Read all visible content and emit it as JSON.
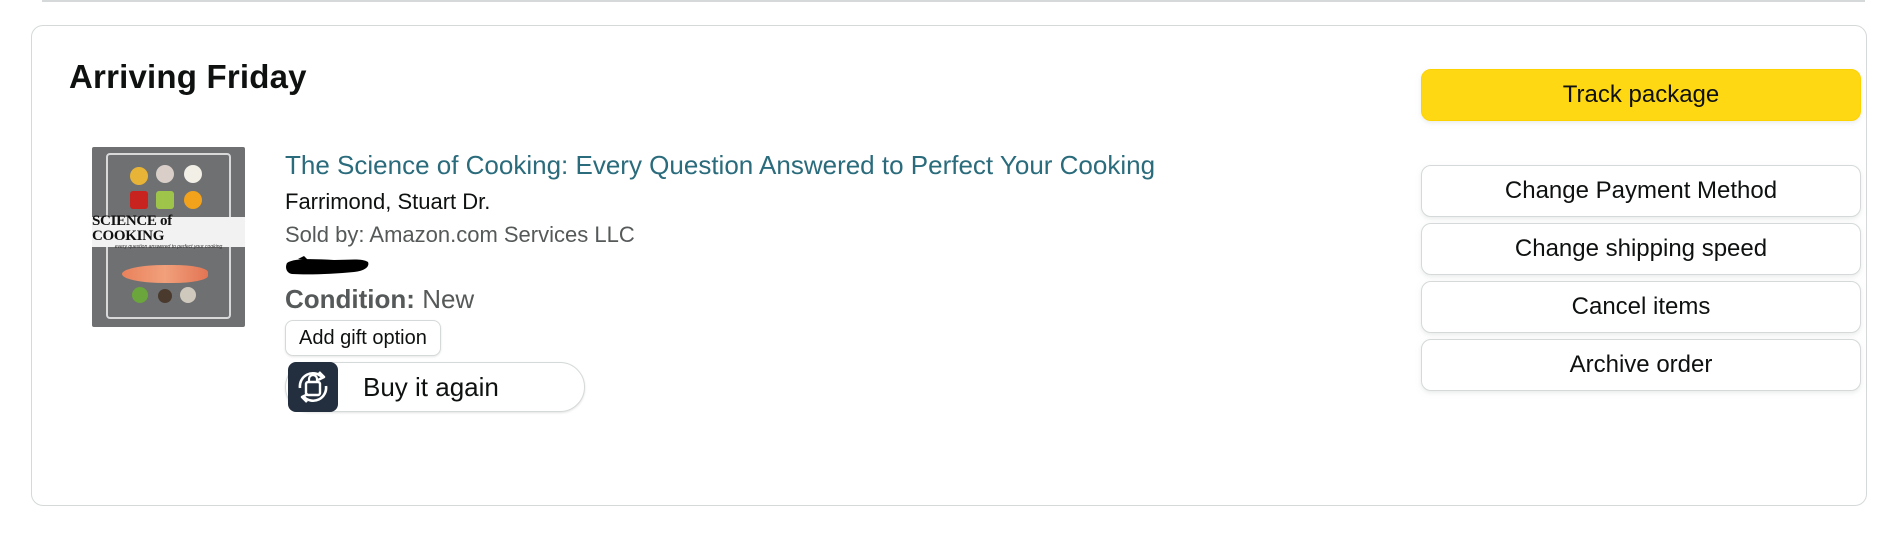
{
  "shipment": {
    "status_title": "Arriving Friday"
  },
  "item": {
    "title": "The Science of Cooking: Every Question Answered to Perfect Your Cooking",
    "author": "Farrimond, Stuart Dr.",
    "seller": "Sold by: Amazon.com Services LLC",
    "condition_label": "Condition:",
    "condition_value": "New",
    "gift_option_label": "Add gift option",
    "buy_again_label": "Buy it again",
    "buy_again_icon": "repeat-bag-icon",
    "cover": {
      "title": "SCIENCE of COOKING",
      "subtitle": "every question answered to perfect your cooking"
    }
  },
  "actions": {
    "track_label": "Track package",
    "buttons": [
      {
        "label": "Change Payment Method"
      },
      {
        "label": "Change shipping speed"
      },
      {
        "label": "Cancel items"
      },
      {
        "label": "Archive order"
      }
    ]
  },
  "colors": {
    "primary_button": "#ffd814",
    "link": "#2a6b7c",
    "border": "#d5d9d9",
    "icon_bg": "#232f3e"
  }
}
